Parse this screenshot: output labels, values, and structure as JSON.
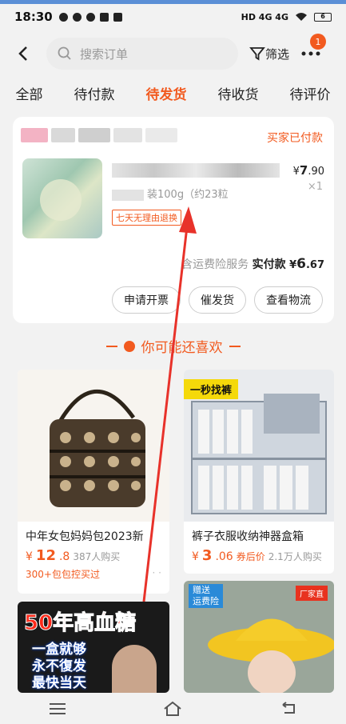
{
  "status_bar": {
    "time": "18:30",
    "network": "HD 4G 4G",
    "battery": "6"
  },
  "header": {
    "search_placeholder": "搜索订单",
    "filter_label": "筛选",
    "badge_count": "1"
  },
  "tabs": [
    {
      "label": "全部",
      "active": false
    },
    {
      "label": "待付款",
      "active": false
    },
    {
      "label": "待发货",
      "active": true
    },
    {
      "label": "待收货",
      "active": false
    },
    {
      "label": "待评价",
      "active": false
    }
  ],
  "order": {
    "status": "买家已付款",
    "spec": "装100g（约23粒",
    "return_tag": "七天无理由退换",
    "price_symbol": "¥",
    "price_int": "7",
    "price_dec": ".90",
    "quantity": "×1",
    "insurance": "含运费险服务",
    "paid_label": "实付款",
    "paid_symbol": "¥",
    "paid_int": "6",
    "paid_dec": ".67",
    "buttons": [
      "申请开票",
      "催发货",
      "查看物流"
    ]
  },
  "recommend_title": "你可能还喜欢",
  "products": [
    {
      "name": "中年女包妈妈包2023新",
      "currency": "¥",
      "price_int": "12",
      "price_dec": ".8",
      "sold": "387人购买",
      "sub": "300+包包控买过"
    },
    {
      "name": "裤子衣服收纳神器盒箱",
      "banner": "一秒找裤",
      "currency": "¥",
      "price_int": "3",
      "price_dec": ".06",
      "note": "券后价",
      "sold": "2.1万人购买"
    },
    {
      "banner": "50年高血糖",
      "lines": [
        "一盒就够",
        "永不復发",
        "最快当天"
      ]
    },
    {
      "tag1": "赠送",
      "tag2": "运费险",
      "shop_tag": "厂家直"
    }
  ],
  "colors": {
    "accent": "#f25a1f",
    "background": "#f2f2f2"
  }
}
